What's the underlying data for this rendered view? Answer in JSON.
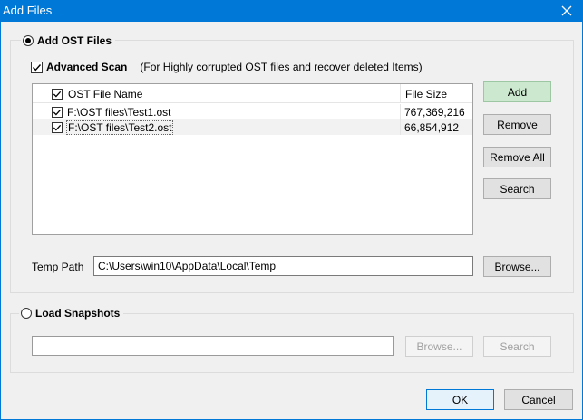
{
  "window": {
    "title": "Add Files",
    "close_icon": "close-icon"
  },
  "ost_group": {
    "radio_label": "Add OST Files",
    "advanced_scan_label": "Advanced Scan",
    "advanced_scan_note": "(For Highly corrupted OST files and recover deleted Items)",
    "columns": [
      "OST File Name",
      "File Size"
    ],
    "rows": [
      {
        "name": "F:\\OST files\\Test1.ost",
        "size": "767,369,216"
      },
      {
        "name": "F:\\OST files\\Test2.ost",
        "size": "66,854,912"
      }
    ],
    "buttons": {
      "add": "Add",
      "remove": "Remove",
      "remove_all": "Remove All",
      "search": "Search"
    },
    "temp_path_label": "Temp Path",
    "temp_path_value": "C:\\Users\\win10\\AppData\\Local\\Temp",
    "browse": "Browse..."
  },
  "snapshot_group": {
    "radio_label": "Load Snapshots",
    "path_value": "",
    "browse": "Browse...",
    "search": "Search"
  },
  "footer": {
    "ok": "OK",
    "cancel": "Cancel"
  },
  "colors": {
    "titlebar": "#0078d7",
    "add_button": "#cce8cf"
  }
}
